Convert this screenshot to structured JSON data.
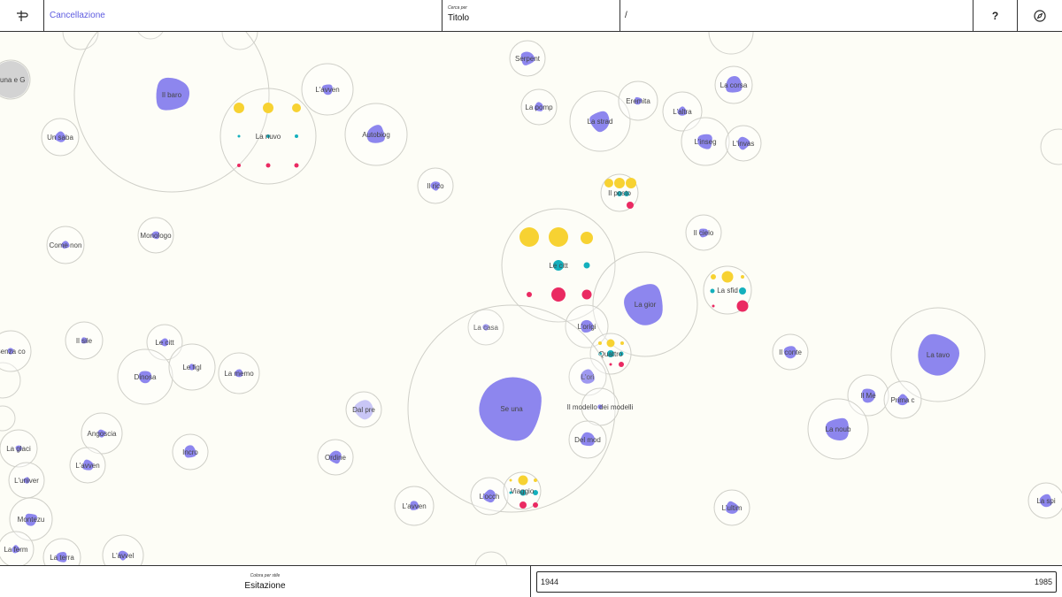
{
  "header": {
    "breadcrumb": "Cancellazione",
    "search_by_label": "Cerca per",
    "search_by_value": "Titolo",
    "search_prefix": "/",
    "help_label": "?"
  },
  "footer": {
    "color_by_label": "Colora per stile",
    "color_by_value": "Esitazione",
    "range_start": "1944",
    "range_end": "1985"
  },
  "colors": {
    "blob": "#8d86ee",
    "blob_light": "#c9c6f6",
    "yellow": "#f7d232",
    "teal": "#14b0bd",
    "pink": "#ea2a62",
    "accent": "#5d5be0"
  },
  "nodes": [
    {
      "label": "Luna e G",
      "kind": "gray"
    },
    {
      "label": "Il baro",
      "kind": "blob"
    },
    {
      "label": "Un saba",
      "kind": "blob"
    },
    {
      "label": "L'avven",
      "kind": "blob"
    },
    {
      "label": "La nuvo",
      "kind": "dots"
    },
    {
      "label": "Autobiog",
      "kind": "blob"
    },
    {
      "label": "Il rico",
      "kind": "blob"
    },
    {
      "label": "Serpent",
      "kind": "blob"
    },
    {
      "label": "La pomp",
      "kind": "blob"
    },
    {
      "label": "La strad",
      "kind": "blob"
    },
    {
      "label": "Eremita",
      "kind": "blob"
    },
    {
      "label": "L'altra",
      "kind": "blob"
    },
    {
      "label": "L'inseg",
      "kind": "blob"
    },
    {
      "label": "L'invas",
      "kind": "blob"
    },
    {
      "label": "La corsa",
      "kind": "blob"
    },
    {
      "label": "Il posto",
      "kind": "dots"
    },
    {
      "label": "Il cielo",
      "kind": "blob"
    },
    {
      "label": "Le citt",
      "kind": "dots"
    },
    {
      "label": "La gior",
      "kind": "blob"
    },
    {
      "label": "La sfid",
      "kind": "dots"
    },
    {
      "label": "Come non",
      "kind": "blob"
    },
    {
      "label": "Monologo",
      "kind": "blob"
    },
    {
      "label": "Senza co",
      "kind": "blob"
    },
    {
      "label": "Il sile",
      "kind": "blob"
    },
    {
      "label": "Le citt",
      "kind": "blob"
    },
    {
      "label": "Dinosa",
      "kind": "blob"
    },
    {
      "label": "Le figl",
      "kind": "blob"
    },
    {
      "label": "La memo",
      "kind": "blob"
    },
    {
      "label": "La casa",
      "kind": "blob"
    },
    {
      "label": "L'origi",
      "kind": "blob"
    },
    {
      "label": "Quattro",
      "kind": "dots"
    },
    {
      "label": "Il conte",
      "kind": "blob"
    },
    {
      "label": "La tavo",
      "kind": "blob"
    },
    {
      "label": "L'ori",
      "kind": "blob"
    },
    {
      "label": "Se una",
      "kind": "blob"
    },
    {
      "label": "Il modello dei modelli",
      "kind": "blob"
    },
    {
      "label": "Del mod",
      "kind": "blob"
    },
    {
      "label": "Dal pre",
      "kind": "blob"
    },
    {
      "label": "Il Me",
      "kind": "blob"
    },
    {
      "label": "Prima c",
      "kind": "blob"
    },
    {
      "label": "La noub",
      "kind": "blob"
    },
    {
      "label": "Angoscia",
      "kind": "blob"
    },
    {
      "label": "Incro",
      "kind": "blob"
    },
    {
      "label": "Ordine",
      "kind": "blob"
    },
    {
      "label": "La glaci",
      "kind": "blob"
    },
    {
      "label": "L'avven",
      "kind": "blob"
    },
    {
      "label": "L'univer",
      "kind": "blob"
    },
    {
      "label": "Montezu",
      "kind": "blob"
    },
    {
      "label": "La ferm",
      "kind": "blob"
    },
    {
      "label": "La terra",
      "kind": "blob"
    },
    {
      "label": "L'avvel",
      "kind": "blob"
    },
    {
      "label": "L'avven",
      "kind": "blob"
    },
    {
      "label": "L'occh",
      "kind": "blob"
    },
    {
      "label": "Viaggio",
      "kind": "dots"
    },
    {
      "label": "L'ultim",
      "kind": "blob"
    },
    {
      "label": "La spi",
      "kind": "blob"
    }
  ]
}
